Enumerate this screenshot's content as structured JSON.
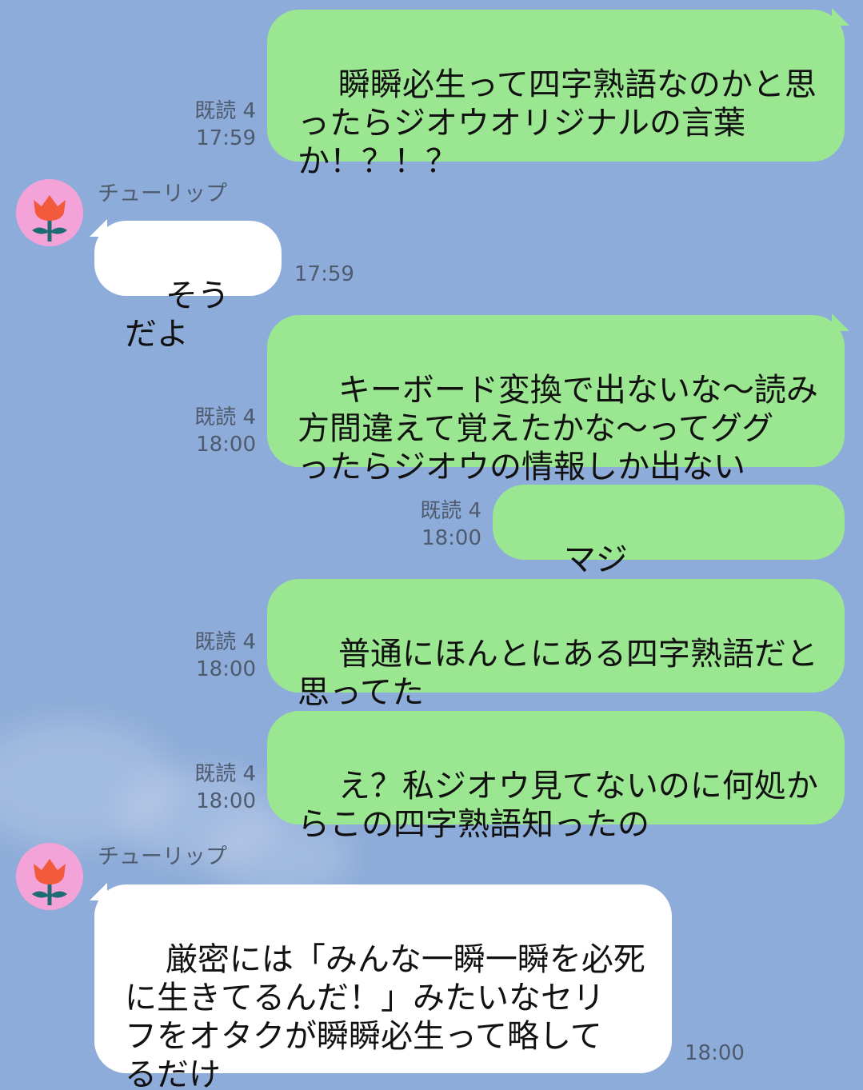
{
  "colors": {
    "background": "#8eacd9",
    "outgoing_bubble": "#9be690",
    "incoming_bubble": "#ffffff",
    "avatar_bg": "#f4a3d9",
    "tulip_red": "#f25a3c",
    "tulip_stem": "#1f6b74"
  },
  "contact": {
    "name": "チューリップ",
    "avatar_icon": "tulip-icon"
  },
  "messages": [
    {
      "direction": "out",
      "read": "既読 4",
      "time": "17:59",
      "text": "瞬瞬必生って四字熟語なのかと思\nったらジオウオリジナルの言葉\nか！？！？"
    },
    {
      "direction": "in",
      "sender": "チューリップ",
      "time": "17:59",
      "text": "そうだよ"
    },
    {
      "direction": "out",
      "read": "既読 4",
      "time": "18:00",
      "text": "キーボード変換で出ないな〜読み\n方間違えて覚えたかな〜ってググ\nったらジオウの情報しか出ない"
    },
    {
      "direction": "out",
      "read": "既読 4",
      "time": "18:00",
      "text": "マジで！？！？！？"
    },
    {
      "direction": "out",
      "read": "既読 4",
      "time": "18:00",
      "text": "普通にほんとにある四字熟語だと\n思ってた"
    },
    {
      "direction": "out",
      "read": "既読 4",
      "time": "18:00",
      "text": "え？私ジオウ見てないのに何処か\nらこの四字熟語知ったの"
    },
    {
      "direction": "in",
      "sender": "チューリップ",
      "time": "18:00",
      "text": "厳密には「みんな一瞬一瞬を必死\nに生きてるんだ！」みたいなセリ\nフをオタクが瞬瞬必生って略して\nるだけ"
    }
  ]
}
